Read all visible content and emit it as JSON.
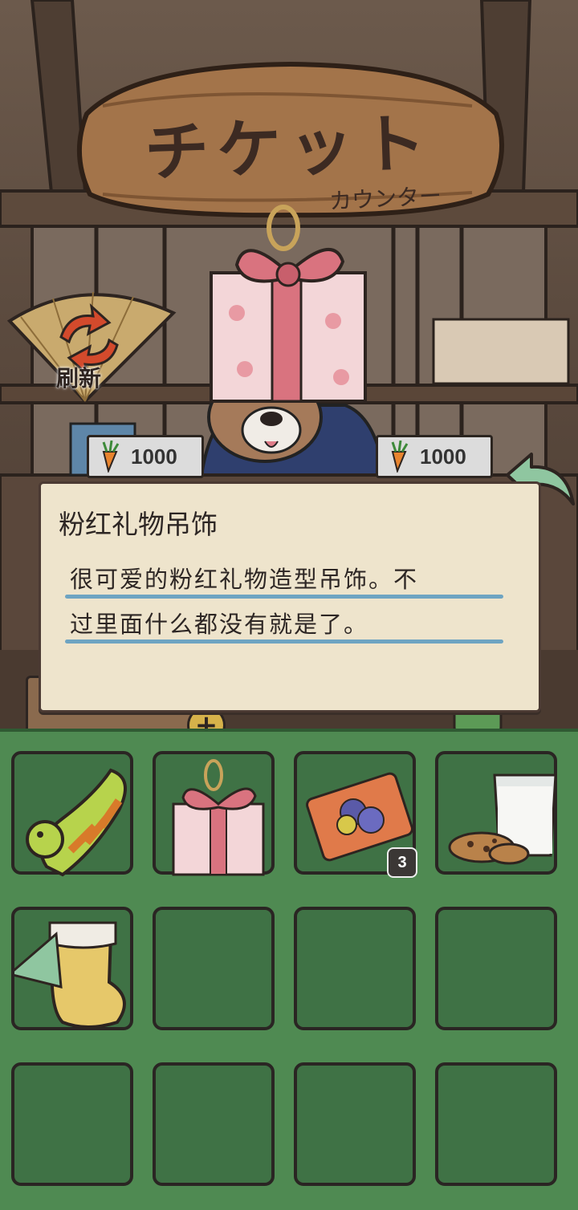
{
  "booth": {
    "sign_title": "チケット",
    "sign_subtitle": "カウンター"
  },
  "refresh": {
    "label": "刷新",
    "icon": "refresh-arrows-icon"
  },
  "shop": {
    "prices": [
      {
        "currency_icon": "carrot-icon",
        "value": "1000"
      },
      {
        "currency_icon": "carrot-icon",
        "value": "1000"
      }
    ]
  },
  "item_detail": {
    "name": "粉红礼物吊饰",
    "description_lines": [
      "很可爱的粉红礼物造型吊饰。不",
      "过里面什么都没有就是了。"
    ]
  },
  "currency": {
    "add_label": "+"
  },
  "inventory": {
    "slots": [
      {
        "item": "swim-ring-duck",
        "count": ""
      },
      {
        "item": "pink-gift-charm",
        "count": ""
      },
      {
        "item": "collection-ticket",
        "count": "3"
      },
      {
        "item": "milk-and-cookies",
        "count": ""
      },
      {
        "item": "christmas-stocking",
        "count": ""
      },
      {
        "item": "empty",
        "count": ""
      },
      {
        "item": "empty",
        "count": ""
      },
      {
        "item": "empty",
        "count": ""
      },
      {
        "item": "empty",
        "count": ""
      },
      {
        "item": "empty",
        "count": ""
      },
      {
        "item": "empty",
        "count": ""
      },
      {
        "item": "empty",
        "count": ""
      }
    ]
  },
  "colors": {
    "panel_bg": "#eee4cc",
    "rule_blue": "#6ea4c2",
    "inventory_green": "#4f8a52",
    "slot_green": "#3f7245"
  }
}
